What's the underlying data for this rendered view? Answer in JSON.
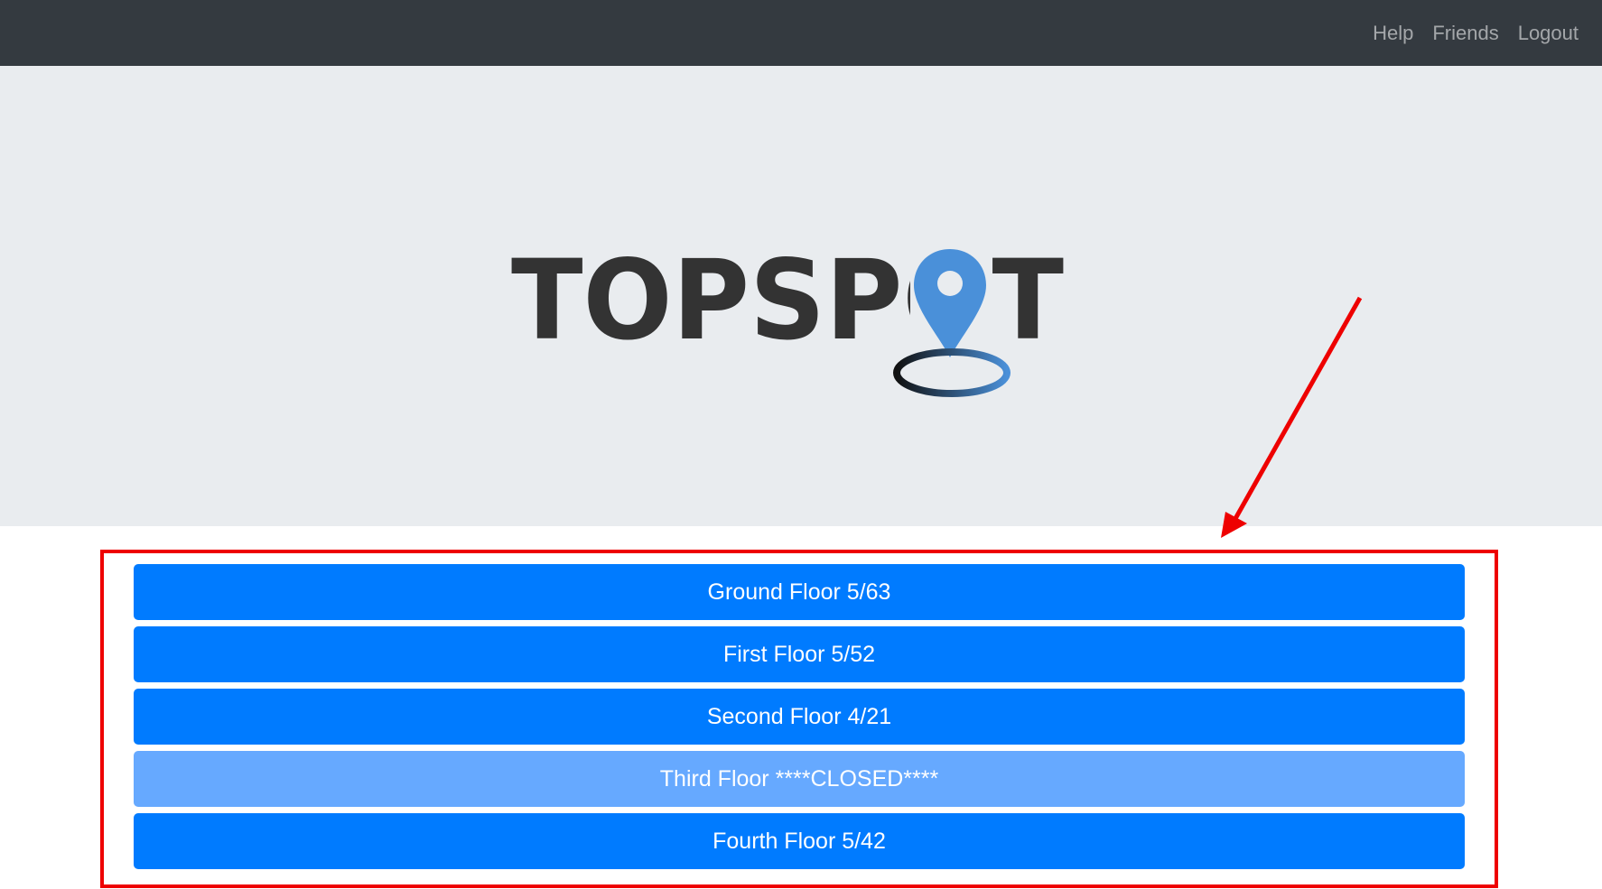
{
  "nav": {
    "links": [
      "Help",
      "Friends",
      "Logout"
    ]
  },
  "logo": {
    "text": "TOPSPOT"
  },
  "floors": [
    {
      "label": "Ground Floor 5/63",
      "closed": false
    },
    {
      "label": "First Floor 5/52",
      "closed": false
    },
    {
      "label": "Second Floor 4/21",
      "closed": false
    },
    {
      "label": "Third Floor ****CLOSED****",
      "closed": true
    },
    {
      "label": "Fourth Floor 5/42",
      "closed": false
    }
  ],
  "colors": {
    "navbar": "#343a40",
    "hero": "#e9ecef",
    "primary": "#007bff",
    "disabled": "#66a9ff",
    "annotation": "#ee0000",
    "logo_text": "#333333",
    "pin": "#4a90d9"
  }
}
